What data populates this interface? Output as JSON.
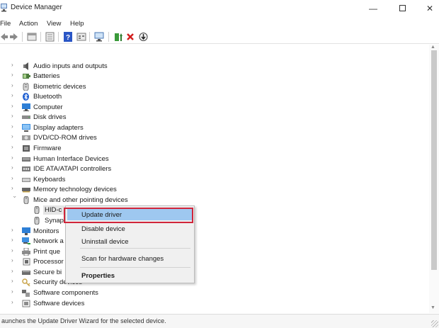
{
  "window": {
    "title": "Device Manager",
    "minimize_glyph": "—",
    "close_glyph": "✕"
  },
  "menu": [
    "File",
    "Action",
    "View",
    "Help"
  ],
  "tree": {
    "items": [
      {
        "label": "Audio inputs and outputs",
        "icon": "speaker-icon"
      },
      {
        "label": "Batteries",
        "icon": "battery-icon"
      },
      {
        "label": "Biometric devices",
        "icon": "fingerprint-icon"
      },
      {
        "label": "Bluetooth",
        "icon": "bluetooth-icon"
      },
      {
        "label": "Computer",
        "icon": "computer-icon"
      },
      {
        "label": "Disk drives",
        "icon": "disk-drive-icon"
      },
      {
        "label": "Display adapters",
        "icon": "display-adapter-icon"
      },
      {
        "label": "DVD/CD-ROM drives",
        "icon": "dvd-drive-icon"
      },
      {
        "label": "Firmware",
        "icon": "firmware-icon"
      },
      {
        "label": "Human Interface Devices",
        "icon": "hid-icon"
      },
      {
        "label": "IDE ATA/ATAPI controllers",
        "icon": "ide-controller-icon"
      },
      {
        "label": "Keyboards",
        "icon": "keyboard-icon"
      },
      {
        "label": "Memory technology devices",
        "icon": "memory-icon"
      },
      {
        "label": "Mice and other pointing devices",
        "icon": "mouse-icon"
      },
      {
        "label": "HID-c",
        "icon": "mouse-icon"
      },
      {
        "label": "Synap",
        "icon": "mouse-icon"
      },
      {
        "label": "Monitors",
        "icon": "monitor-icon"
      },
      {
        "label": "Network a",
        "icon": "network-adapter-icon"
      },
      {
        "label": "Print que",
        "icon": "printer-icon"
      },
      {
        "label": "Processor",
        "icon": "processor-icon"
      },
      {
        "label": "Secure bi",
        "icon": "secure-boot-icon"
      },
      {
        "label": "Security devices",
        "icon": "security-device-icon"
      },
      {
        "label": "Software components",
        "icon": "software-component-icon"
      },
      {
        "label": "Software devices",
        "icon": "software-device-icon"
      }
    ]
  },
  "context_menu": {
    "update": "Update driver",
    "disable": "Disable device",
    "uninstall": "Uninstall device",
    "scan": "Scan for hardware changes",
    "properties": "Properties"
  },
  "status": "aunches the Update Driver Wizard for the selected device.",
  "colors": {
    "highlight": "#9ec8f0",
    "annotation_border": "#d0253b",
    "selection": "#e5e5e5"
  }
}
